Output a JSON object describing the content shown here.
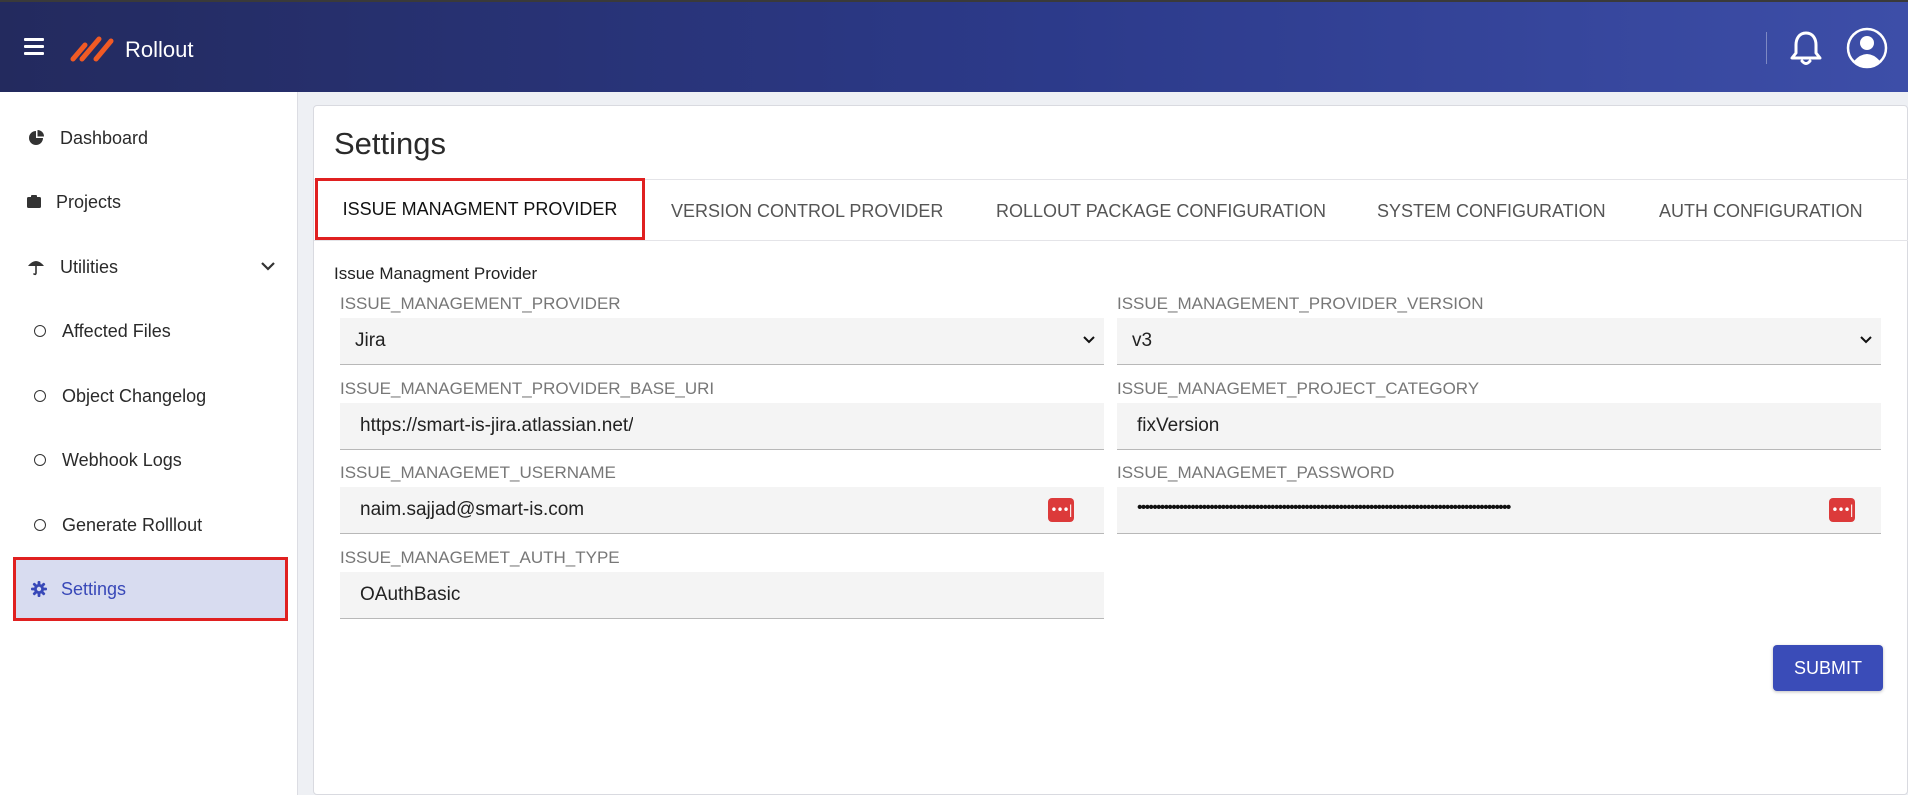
{
  "app": {
    "brand": "Rollout"
  },
  "sidebar": {
    "items": [
      {
        "label": "Dashboard",
        "icon": "pie-chart-icon"
      },
      {
        "label": "Projects",
        "icon": "folder-icon"
      },
      {
        "label": "Utilities",
        "icon": "umbrella-icon"
      },
      {
        "label": "Affected Files",
        "icon": "circle-icon"
      },
      {
        "label": "Object Changelog",
        "icon": "circle-icon"
      },
      {
        "label": "Webhook Logs",
        "icon": "circle-icon"
      },
      {
        "label": "Generate Rolllout",
        "icon": "circle-icon"
      },
      {
        "label": "Settings",
        "icon": "gear-icon"
      }
    ]
  },
  "main": {
    "title": "Settings",
    "tabs": [
      {
        "label": "ISSUE MANAGMENT PROVIDER"
      },
      {
        "label": "VERSION CONTROL PROVIDER"
      },
      {
        "label": "ROLLOUT PACKAGE CONFIGURATION"
      },
      {
        "label": "SYSTEM CONFIGURATION"
      },
      {
        "label": "AUTH CONFIGURATION"
      }
    ],
    "section_label": "Issue Managment Provider",
    "fields": {
      "provider": {
        "label": "ISSUE_MANAGEMENT_PROVIDER",
        "value": "Jira"
      },
      "provider_version": {
        "label": "ISSUE_MANAGEMENT_PROVIDER_VERSION",
        "value": "v3"
      },
      "base_uri": {
        "label": "ISSUE_MANAGEMENT_PROVIDER_BASE_URI",
        "value": "https://smart-is-jira.atlassian.net/"
      },
      "project_category": {
        "label": "ISSUE_MANAGEMET_PROJECT_CATEGORY",
        "value": "fixVersion"
      },
      "username": {
        "label": "ISSUE_MANAGEMET_USERNAME",
        "value": "naim.sajjad@smart-is.com"
      },
      "password": {
        "label": "ISSUE_MANAGEMET_PASSWORD",
        "value": "••••••••••••••••••••••••••••••••••••••••••••••••••••••••••••••••••••••••••••••••••••••••••••••••••"
      },
      "auth_type": {
        "label": "ISSUE_MANAGEMET_AUTH_TYPE",
        "value": "OAuthBasic"
      }
    },
    "submit_label": "SUBMIT"
  }
}
